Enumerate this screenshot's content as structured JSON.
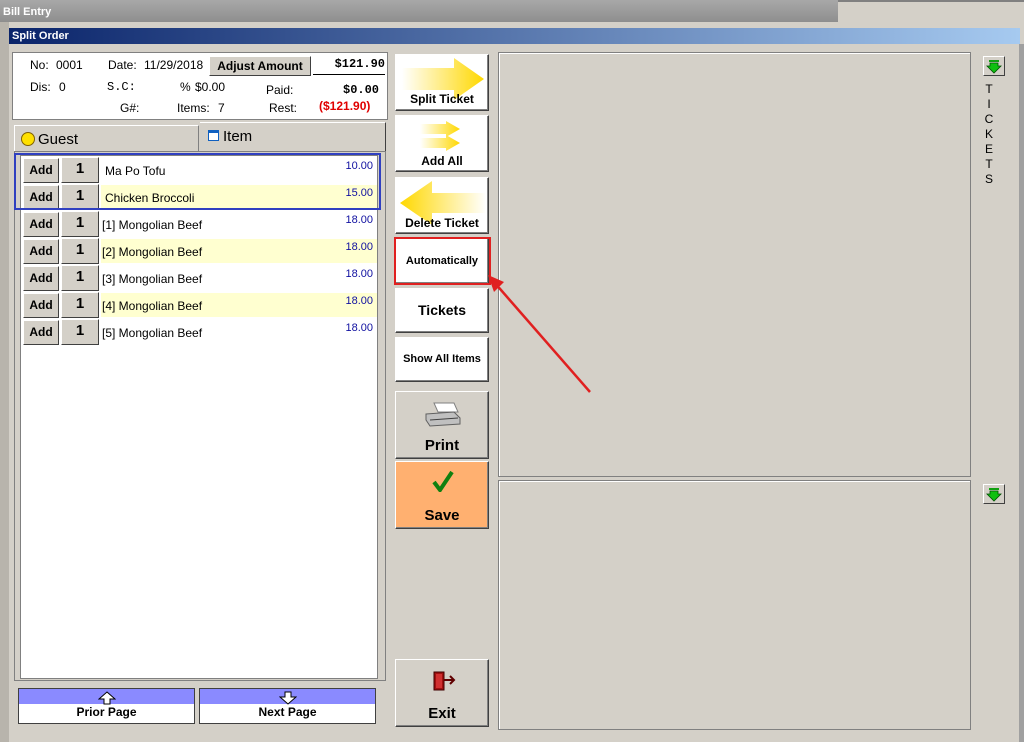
{
  "window": {
    "outer_title": "Bill Entry",
    "inner_title": "Split Order"
  },
  "info": {
    "no_label": "No:",
    "no_value": "0001",
    "date_label": "Date:",
    "date_value": "11/29/2018",
    "adjust_label": "Adjust Amount",
    "total": "$121.90",
    "dis_label": "Dis:",
    "dis_value": "0",
    "sc_label": "S.C:",
    "sc_percent": "%",
    "sc_value": "$0.00",
    "paid_label": "Paid:",
    "paid_value": "$0.00",
    "g_label": "G#:",
    "items_label": "Items:",
    "items_value": "7",
    "rest_label": "Rest:",
    "rest_value": "($121.90)"
  },
  "tabs": {
    "guest": "Guest",
    "item": "Item"
  },
  "rows": [
    {
      "add": "Add",
      "qty": "1",
      "name": "Ma Po Tofu",
      "price": "10.00"
    },
    {
      "add": "Add",
      "qty": "1",
      "name": "Chicken Broccoli",
      "price": "15.00"
    },
    {
      "add": "Add",
      "qty": "1",
      "name": "[1] Mongolian Beef",
      "price": "18.00"
    },
    {
      "add": "Add",
      "qty": "1",
      "name": "[2] Mongolian Beef",
      "price": "18.00"
    },
    {
      "add": "Add",
      "qty": "1",
      "name": "[3] Mongolian Beef",
      "price": "18.00"
    },
    {
      "add": "Add",
      "qty": "1",
      "name": "[4] Mongolian Beef",
      "price": "18.00"
    },
    {
      "add": "Add",
      "qty": "1",
      "name": "[5] Mongolian Beef",
      "price": "18.00"
    }
  ],
  "paging": {
    "prior": "Prior Page",
    "next": "Next Page"
  },
  "actions": {
    "split_ticket": "Split Ticket",
    "add_all": "Add All",
    "delete_ticket": "Delete Ticket",
    "automatically": "Automatically",
    "tickets": "Tickets",
    "show_all_items": "Show All Items",
    "print": "Print",
    "save": "Save",
    "exit": "Exit"
  },
  "side_label": "TICKETS",
  "colors": {
    "save_bg": "#ffb070",
    "highlight": "#e02020",
    "arrow_yellow": "#ffd800"
  },
  "icons": [
    "split-arrow-icon",
    "add-all-arrow-icon",
    "delete-arrow-icon",
    "printer-icon",
    "checkmark-icon",
    "exit-door-icon",
    "down-arrow-icon",
    "smiley-icon",
    "window-icon"
  ]
}
